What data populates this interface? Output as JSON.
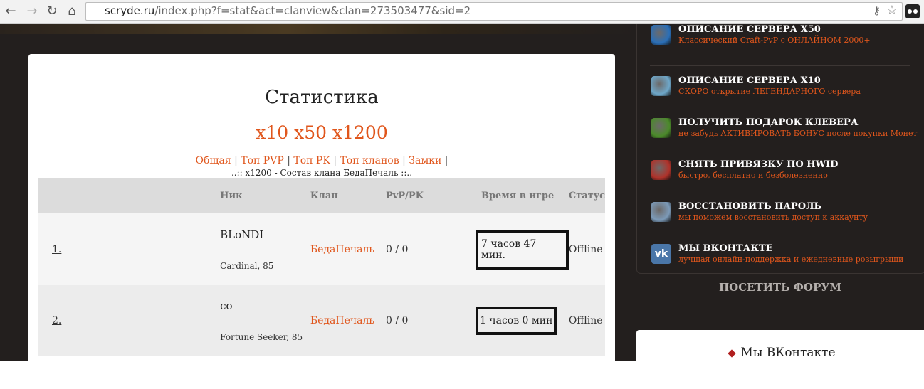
{
  "browser": {
    "url_host": "scryde.ru",
    "url_path": "/index.php?f=stat&act=clanview&clan=273503477&sid=2"
  },
  "main": {
    "title": "Статистика",
    "servers": "x10 x50 x1200",
    "nav_links": [
      "Общая",
      "Топ PVP",
      "Топ PK",
      "Топ кланов",
      "Замки"
    ],
    "subtitle": "..:: x1200 - Состав клана БедаПечаль ::..",
    "table": {
      "headers": [
        "Ник",
        "Клан",
        "PvP/PK",
        "Время в игре",
        "Статус"
      ],
      "rows": [
        {
          "num": "1.",
          "nick": "BLoNDI",
          "class": "Cardinal, 85",
          "clan": "БедаПечаль",
          "pvppk": "0 / 0",
          "time": "7 часов 47 мин.",
          "status": "Offline"
        },
        {
          "num": "2.",
          "nick": "co",
          "class": "Fortune Seeker, 85",
          "clan": "БедаПечаль",
          "pvppk": "0 / 0",
          "time": "1 часов 0 мин",
          "status": "Offline"
        }
      ]
    }
  },
  "sidebar": {
    "items": [
      {
        "title": "ОПИСАНИЕ СЕРВЕРА X50",
        "desc": "Классический Craft-PvP с ОНЛАЙНОМ 2000+",
        "icon": "crystal-icon",
        "color": "#2a6fb8"
      },
      {
        "title": "ОПИСАНИЕ СЕРВЕРА X10",
        "desc": "СКОРО открытие ЛЕГЕНДАРНОГО сервера",
        "icon": "ice-sword-icon",
        "color": "#6ea7c9"
      },
      {
        "title": "ПОЛУЧИТЬ ПОДАРОК КЛЕВЕРА",
        "desc": "не забудь АКТИВИРОВАТЬ БОНУС после покупки Монет",
        "icon": "clover-icon",
        "color": "#4b8a2a"
      },
      {
        "title": "СНЯТЬ ПРИВЯЗКУ ПО HWID",
        "desc": "быстро, бесплатно и безболезненно",
        "icon": "red-armor-icon",
        "color": "#b0322a"
      },
      {
        "title": "ВОССТАНОВИТЬ ПАРОЛЬ",
        "desc": "мы поможем восстановить доступ к аккаунту",
        "icon": "angel-icon",
        "color": "#7c9ab8"
      },
      {
        "title": "МЫ ВКОНТАКТЕ",
        "desc": "лучшая онлайн-поддержка и ежедневные розыгрыши",
        "icon": "vk-icon",
        "color": "#4a76a8",
        "icon_text": "vk"
      }
    ],
    "forum_label": "ПОСЕТИТЬ ФОРУМ",
    "vk_card_title": "Мы ВКонтакте"
  },
  "colors": {
    "accent": "#e0561c",
    "page_bg": "#231f1e"
  }
}
